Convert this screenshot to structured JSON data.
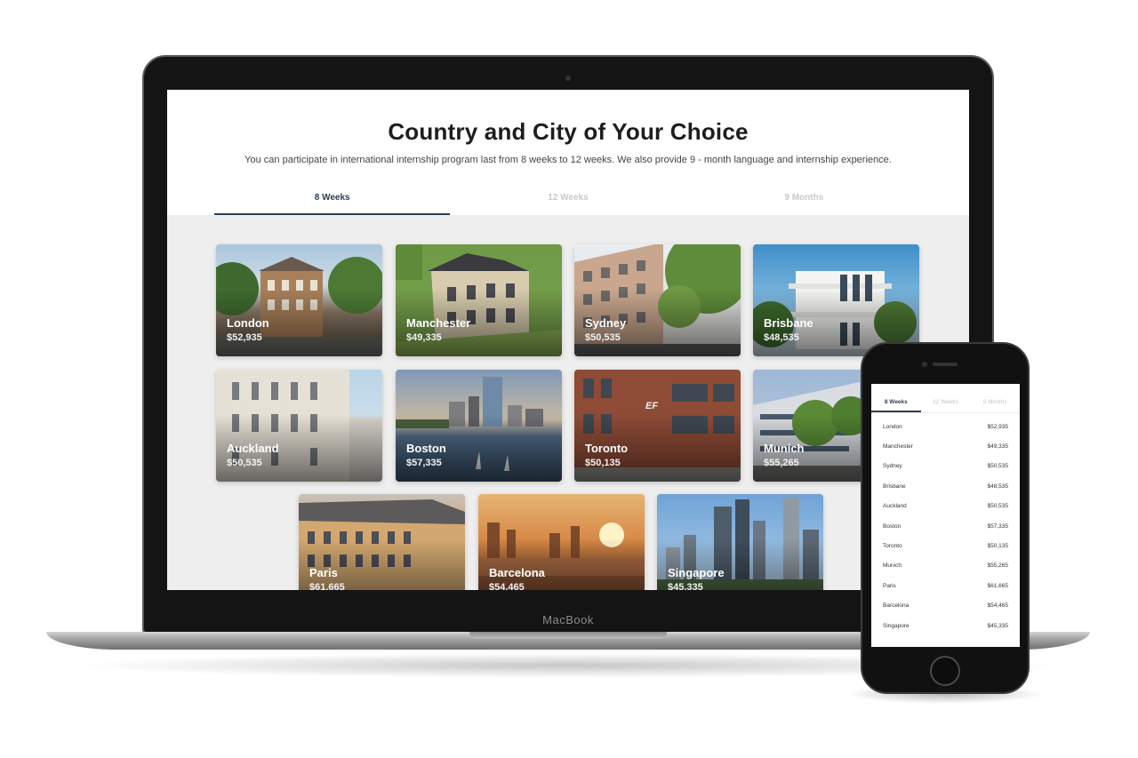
{
  "laptop": {
    "brand": "MacBook",
    "screen": {
      "title": "Country and City of Your Choice",
      "subtitle": "You can participate in international internship program last from 8 weeks to 12 weeks. We also provide 9 - month language and internship experience.",
      "tabs": [
        {
          "label": "8 Weeks",
          "active": true
        },
        {
          "label": "12 Weeks",
          "active": false
        },
        {
          "label": "9 Months",
          "active": false
        }
      ],
      "cities": [
        {
          "name": "London",
          "price": "$52,935"
        },
        {
          "name": "Manchester",
          "price": "$49,335"
        },
        {
          "name": "Sydney",
          "price": "$50,535"
        },
        {
          "name": "Brisbane",
          "price": "$48,535"
        },
        {
          "name": "Auckland",
          "price": "$50,535"
        },
        {
          "name": "Boston",
          "price": "$57,335"
        },
        {
          "name": "Toronto",
          "price": "$50,135"
        },
        {
          "name": "Munich",
          "price": "$55,265"
        },
        {
          "name": "Paris",
          "price": "$61,665"
        },
        {
          "name": "Barcelona",
          "price": "$54,465"
        },
        {
          "name": "Singapore",
          "price": "$45,335"
        }
      ]
    }
  },
  "phone": {
    "tabs": [
      {
        "label": "8 Weeks",
        "active": true
      },
      {
        "label": "12 Weeks",
        "active": false
      },
      {
        "label": "9 Months",
        "active": false
      }
    ],
    "rows": [
      {
        "city": "London",
        "price": "$52,935"
      },
      {
        "city": "Manchester",
        "price": "$49,335"
      },
      {
        "city": "Sydney",
        "price": "$50,535"
      },
      {
        "city": "Brisbane",
        "price": "$48,535"
      },
      {
        "city": "Auckland",
        "price": "$50,535"
      },
      {
        "city": "Boston",
        "price": "$57,335"
      },
      {
        "city": "Toronto",
        "price": "$50,135"
      },
      {
        "city": "Munich",
        "price": "$55,265"
      },
      {
        "city": "Paris",
        "price": "$61,665"
      },
      {
        "city": "Barcelona",
        "price": "$54,465"
      },
      {
        "city": "Singapore",
        "price": "$45,335"
      }
    ]
  },
  "colors": {
    "accent": "#2b3f58",
    "laptop_frame": "#141414",
    "screen_bg": "#eeeeee"
  }
}
